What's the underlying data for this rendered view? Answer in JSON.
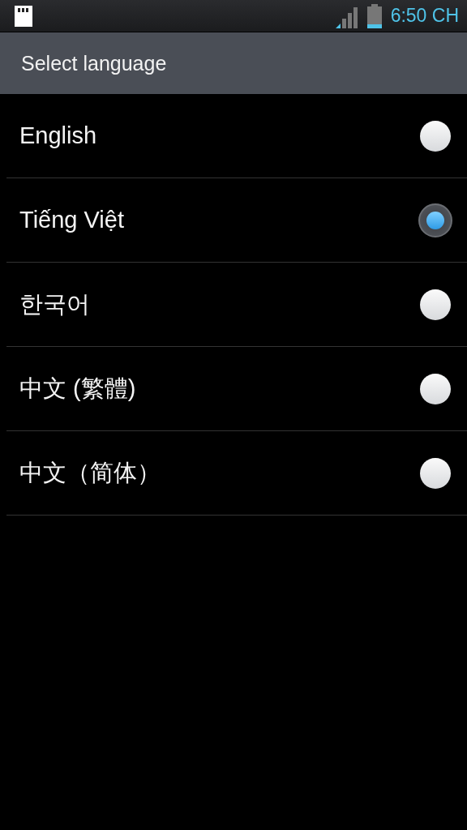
{
  "status_bar": {
    "time": "6:50 CH"
  },
  "title": "Select language",
  "languages": [
    {
      "label": "English",
      "selected": false
    },
    {
      "label": "Tiếng Việt",
      "selected": true
    },
    {
      "label": "한국어",
      "selected": false
    },
    {
      "label": "中文 (繁體)",
      "selected": false
    },
    {
      "label": "中文（简体）",
      "selected": false
    }
  ]
}
